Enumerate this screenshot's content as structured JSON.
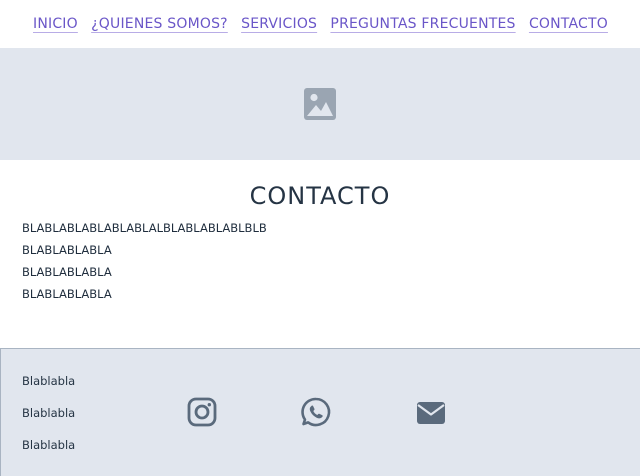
{
  "nav": {
    "items": [
      {
        "label": "INICIO"
      },
      {
        "label": "¿QUIENES SOMOS?"
      },
      {
        "label": "SERVICIOS"
      },
      {
        "label": "PREGUNTAS FRECUENTES"
      },
      {
        "label": "CONTACTO"
      }
    ]
  },
  "banner": {
    "icon": "image-placeholder-icon"
  },
  "contact": {
    "title": "CONTACTO",
    "lines": [
      "BLABLABLABLABLABLALBLABLABLABLBLB",
      "BLABLABLABLA",
      "BLABLABLABLA",
      "BLABLABLABLA"
    ]
  },
  "footer": {
    "links": [
      "Blablabla",
      "Blablabla",
      "Blablabla"
    ],
    "social": [
      "instagram-icon",
      "whatsapp-icon",
      "envelope-icon"
    ]
  },
  "colors": {
    "nav_link": "#6a56c8",
    "band_background": "#e1e6ee",
    "icon": "#5a6a7c"
  }
}
